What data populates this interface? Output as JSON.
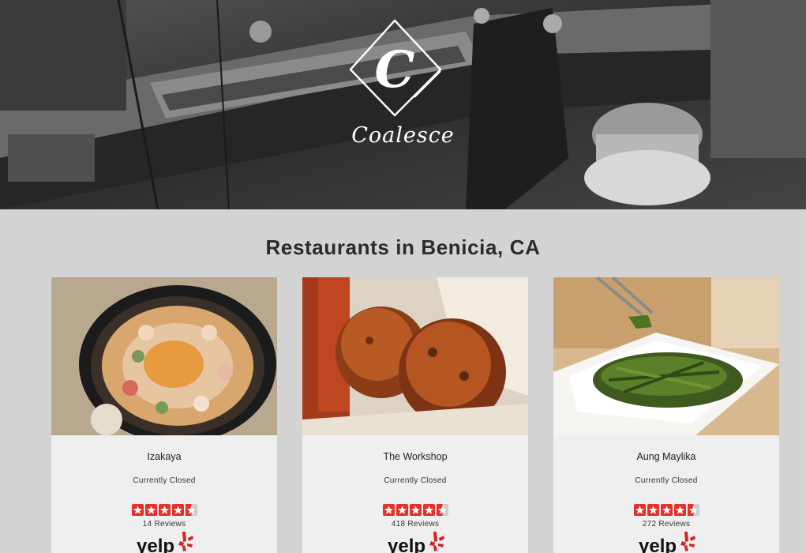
{
  "site": {
    "brand": "Coalesce",
    "logo_letter": "C"
  },
  "section": {
    "title": "Restaurants in Benicia, CA"
  },
  "restaurants": [
    {
      "name": "Izakaya",
      "status": "Currently Closed",
      "rating": 4.5,
      "reviews": "14 Reviews",
      "photo_icon": "sushi-platter-photo"
    },
    {
      "name": "The Workshop",
      "status": "Currently Closed",
      "rating": 4.5,
      "reviews": "418 Reviews",
      "photo_icon": "fried-fritters-photo"
    },
    {
      "name": "Aung Maylika",
      "status": "Currently Closed",
      "rating": 4.5,
      "reviews": "272 Reviews",
      "photo_icon": "green-beans-dish-photo"
    }
  ],
  "yelp": {
    "logo_text": "yelp"
  },
  "colors": {
    "page_bg": "#d3d3d3",
    "card_bg": "#efefef",
    "star_fill": "#e4312b",
    "star_empty": "#cccccc",
    "yelp_red": "#d32323"
  }
}
